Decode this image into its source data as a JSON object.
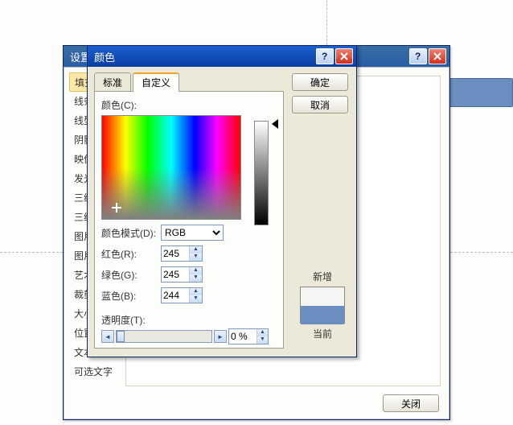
{
  "parent_dialog": {
    "title": "设置形",
    "close_btn": "关闭",
    "side_items": [
      "填充",
      "线条颜",
      "线型",
      "阴影",
      "映像",
      "发光和",
      "三维格",
      "三维旋",
      "图片更",
      "图片颜",
      "艺术效",
      "裁剪",
      "大小",
      "位置",
      "文本框",
      "可选文字"
    ],
    "selected_index": 0
  },
  "color_dialog": {
    "title": "颜色",
    "ok_btn": "确定",
    "cancel_btn": "取消",
    "tabs": {
      "standard": "标准",
      "custom": "自定义",
      "active": "custom"
    },
    "color_label": "颜色(C):",
    "mode_label": "颜色模式(D):",
    "mode_value": "RGB",
    "red_label": "红色(R):",
    "green_label": "绿色(G):",
    "blue_label": "蓝色(B):",
    "red_value": "245",
    "green_value": "245",
    "blue_value": "244",
    "transparency_label": "透明度(T):",
    "transparency_value": "0 %",
    "new_label": "新增",
    "current_label": "当前",
    "colors": {
      "new": "#f5f5f4",
      "current": "#6a8ebf"
    }
  }
}
